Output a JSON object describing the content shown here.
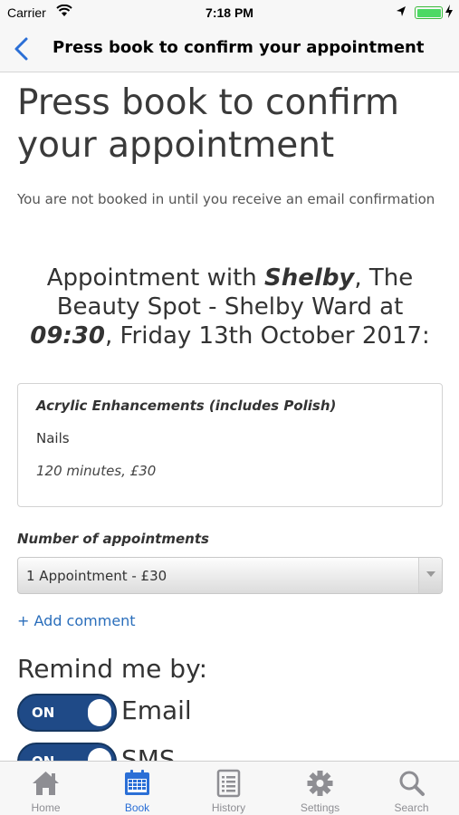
{
  "status_bar": {
    "carrier": "Carrier",
    "time": "7:18 PM",
    "icons": [
      "wifi-icon",
      "location-arrow-icon",
      "battery-icon",
      "charging-icon"
    ]
  },
  "nav": {
    "title": "Press book to confirm your appointment",
    "back_icon": "chevron-left-icon"
  },
  "page": {
    "title": "Press book to confirm your appointment",
    "subtitle": "You are not booked in until you receive an email confirmation"
  },
  "summary": {
    "prefix": "Appointment with ",
    "staff": "Shelby",
    "location": ", The Beauty Spot - Shelby Ward at ",
    "time": "09:30",
    "date": ", Friday 13th October 2017:"
  },
  "service": {
    "name": "Acrylic Enhancements (includes Polish)",
    "category": "Nails",
    "details": "120 minutes, £30"
  },
  "appointments": {
    "label": "Number of appointments",
    "selected": "1 Appointment - £30"
  },
  "add_comment": "+ Add comment",
  "reminders": {
    "title": "Remind me by:",
    "items": [
      {
        "label": "Email",
        "state": "ON"
      },
      {
        "label": "SMS",
        "state": "ON"
      }
    ]
  },
  "tabs": [
    {
      "label": "Home",
      "icon": "home-icon",
      "active": false
    },
    {
      "label": "Book",
      "icon": "calendar-icon",
      "active": true
    },
    {
      "label": "History",
      "icon": "list-document-icon",
      "active": false
    },
    {
      "label": "Settings",
      "icon": "gear-icon",
      "active": false
    },
    {
      "label": "Search",
      "icon": "search-icon",
      "active": false
    }
  ],
  "colors": {
    "accent": "#2b6fd6",
    "toggle_on": "#1f4a87",
    "link": "#2a6ebb",
    "tab_inactive": "#8e8e93"
  }
}
